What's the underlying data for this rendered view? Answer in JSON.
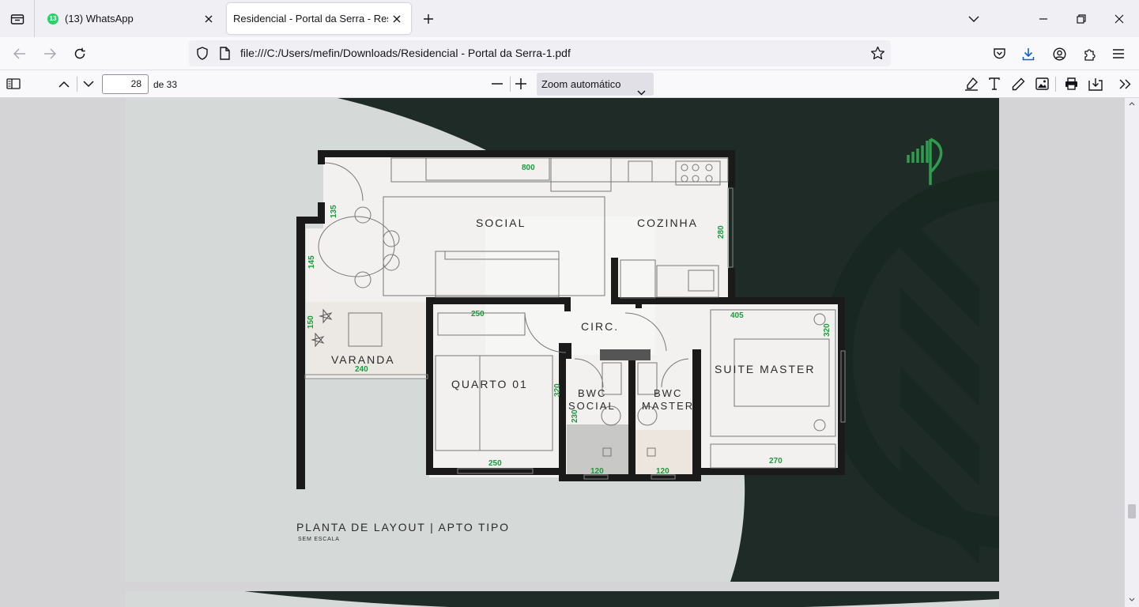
{
  "tabs": [
    {
      "title": "(13) WhatsApp",
      "badge": "13"
    },
    {
      "title": "Residencial - Portal da Serra - Resid"
    }
  ],
  "address": {
    "url": "file:///C:/Users/mefin/Downloads/Residencial - Portal da Serra-1.pdf"
  },
  "pdf_toolbar": {
    "page_number": "28",
    "page_count": "de 33",
    "zoom": "Zoom automático"
  },
  "plan": {
    "rooms": {
      "social": "SOCIAL",
      "cozinha": "COZINHA",
      "circ": "CIRC.",
      "varanda": "VARANDA",
      "quarto": "QUARTO 01",
      "bwc_social_1": "BWC",
      "bwc_social_2": "SOCIAL",
      "bwc_master_1": "BWC",
      "bwc_master_2": "MASTER",
      "suite": "SUITE MASTER"
    },
    "dims": {
      "d800": "800",
      "d135": "135",
      "d145": "145",
      "d280": "280",
      "d150": "150",
      "d240": "240",
      "d250a": "250",
      "d320a": "320",
      "d230": "230",
      "d250b": "250",
      "d120a": "120",
      "d120b": "120",
      "d405": "405",
      "d320b": "320",
      "d270": "270"
    },
    "title": "PLANTA DE LAYOUT | APTO TIPO",
    "subtitle": "SEM ESCALA"
  },
  "colors": {
    "dark_green": "#1e2b26",
    "accent_green": "#2e9e4e",
    "plan_green": "#1d9b3b"
  }
}
